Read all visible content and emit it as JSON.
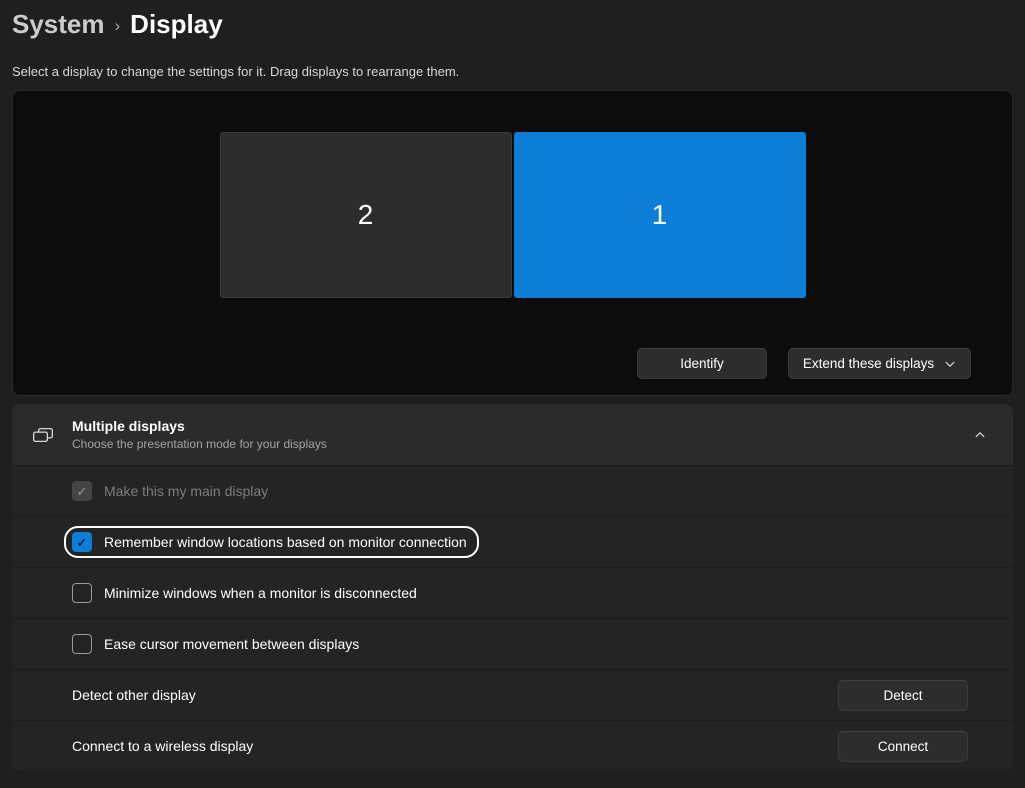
{
  "breadcrumb": {
    "parent": "System",
    "separator": "›",
    "current": "Display"
  },
  "description": "Select a display to change the settings for it. Drag displays to rearrange them.",
  "canvas": {
    "displays": [
      {
        "number": "2",
        "selected": false
      },
      {
        "number": "1",
        "selected": true
      }
    ],
    "identify_label": "Identify",
    "extend_label": "Extend these displays"
  },
  "multiple_displays": {
    "title": "Multiple displays",
    "subtitle": "Choose the presentation mode for your displays",
    "options": [
      {
        "label": "Make this my main display",
        "checked": true,
        "disabled": true,
        "focused": false
      },
      {
        "label": "Remember window locations based on monitor connection",
        "checked": true,
        "disabled": false,
        "focused": true
      },
      {
        "label": "Minimize windows when a monitor is disconnected",
        "checked": false,
        "disabled": false,
        "focused": false
      },
      {
        "label": "Ease cursor movement between displays",
        "checked": false,
        "disabled": false,
        "focused": false
      }
    ],
    "actions": [
      {
        "label": "Detect other display",
        "button_label": "Detect"
      },
      {
        "label": "Connect to a wireless display",
        "button_label": "Connect"
      }
    ]
  },
  "icons": {
    "checkmark": "✓",
    "multiple_displays": "dual-monitor-outline",
    "expander": "chevron-up",
    "dropdown": "chevron-down"
  },
  "colors": {
    "accent": "#0d7dd8",
    "page_bg": "#1f1f1f",
    "canvas_bg": "#0c0c0c",
    "card_header_bg": "#2b2b2b",
    "row_bg": "#242424",
    "inactive_display_bg": "#2d2d2d"
  }
}
